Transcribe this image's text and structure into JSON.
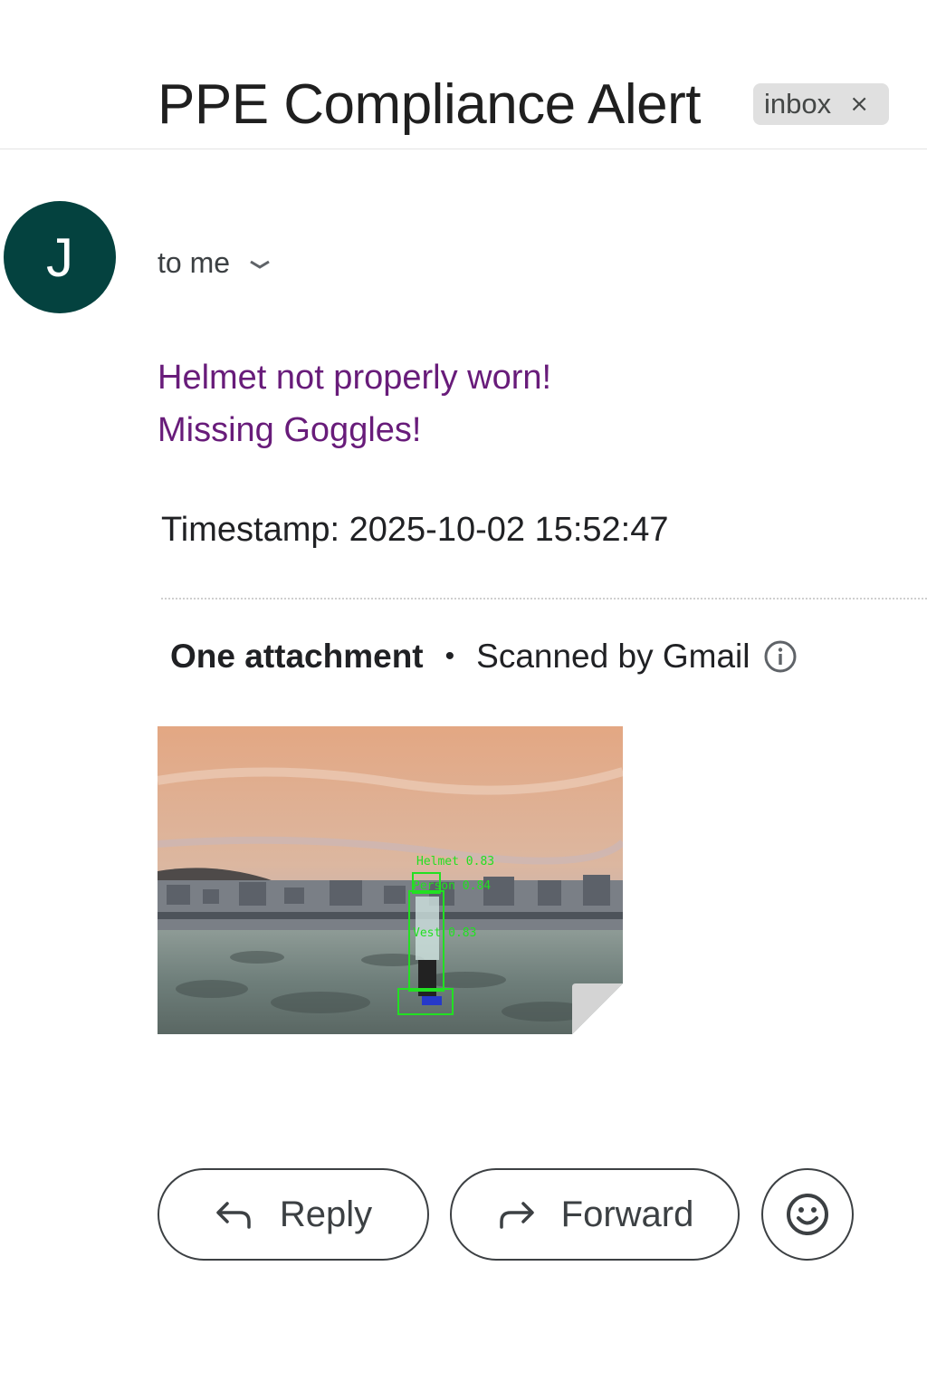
{
  "header": {
    "subject": "PPE Compliance Alert",
    "label": "inbox",
    "label_remove": "×"
  },
  "sender": {
    "avatar_letter": "J",
    "avatar_color": "#04423f",
    "recipient_text": "to me"
  },
  "body": {
    "alerts": [
      "Helmet not properly worn!",
      "Missing Goggles!"
    ],
    "alert_color": "#681c7a",
    "timestamp_label": "Timestamp:",
    "timestamp_value": "2025-10-02 15:52:47"
  },
  "attachments": {
    "count_label": "One attachment",
    "separator": "•",
    "scan_label": "Scanned by Gmail",
    "image": {
      "detection_labels": [
        "Helmet 0.83",
        "Person 0.84",
        "Vest 0.83"
      ]
    }
  },
  "actions": {
    "reply_label": "Reply",
    "forward_label": "Forward",
    "emoji_icon": "smiley-icon"
  }
}
